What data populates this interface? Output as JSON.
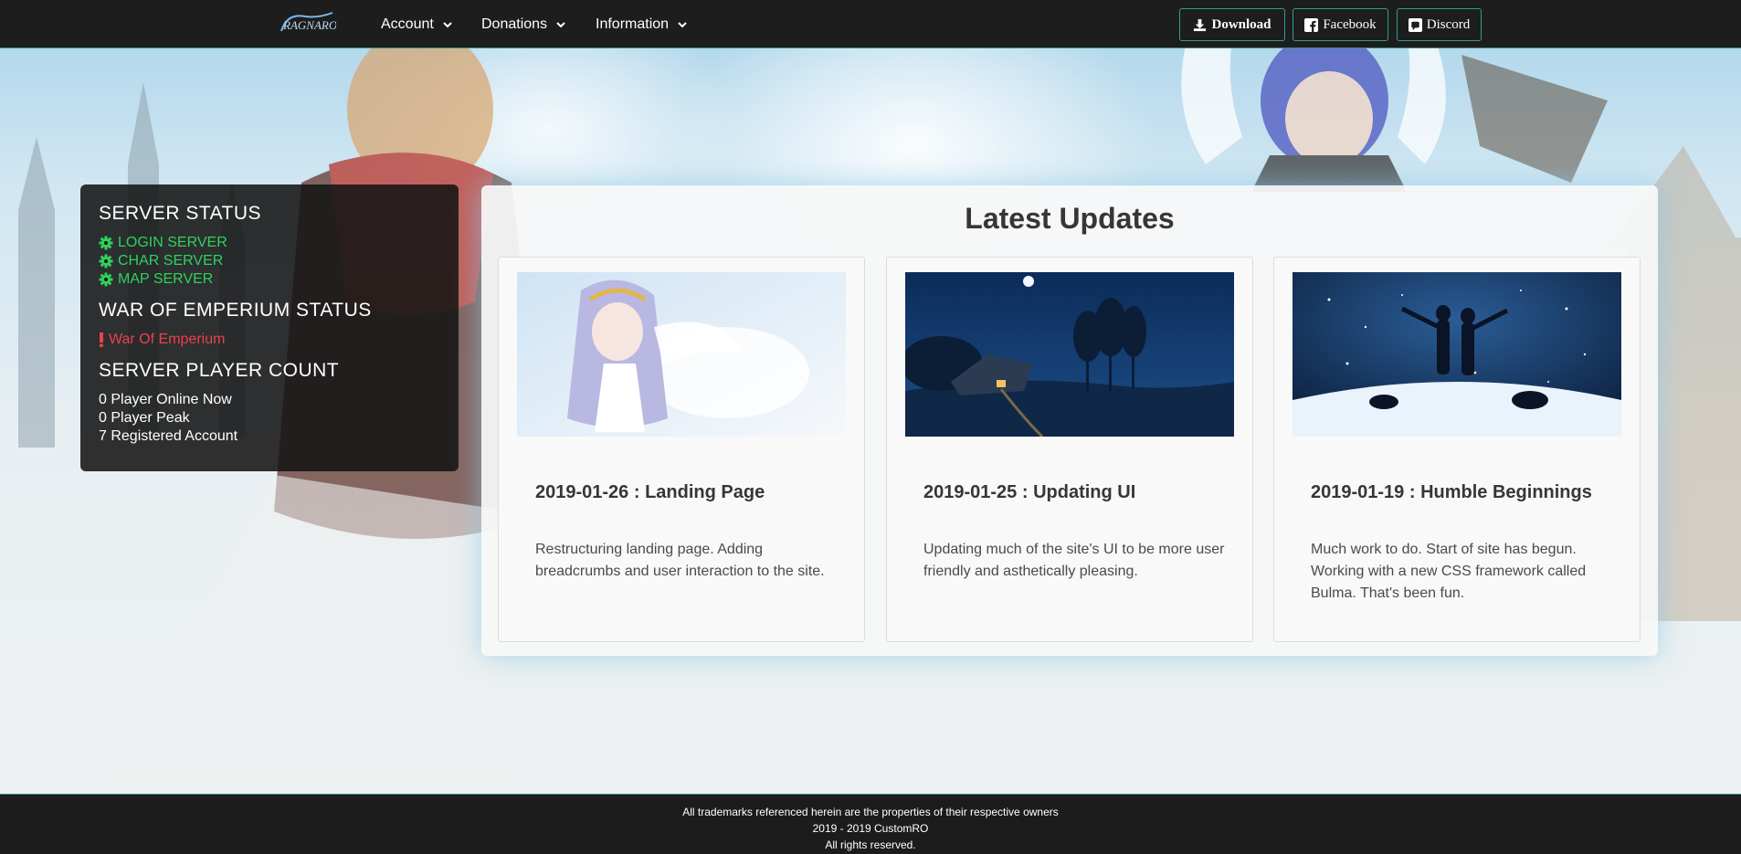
{
  "nav": {
    "logo_alt": "Ragnarok",
    "menu": [
      {
        "label": "Account"
      },
      {
        "label": "Donations"
      },
      {
        "label": "Information"
      }
    ],
    "buttons": {
      "download": "Download",
      "facebook": "Facebook",
      "discord": "Discord"
    }
  },
  "status": {
    "server_heading": "SERVER STATUS",
    "servers": [
      "LOGIN SERVER",
      "CHAR SERVER",
      "MAP SERVER"
    ],
    "woe_heading": "WAR OF EMPERIUM STATUS",
    "woe_label": "War Of Emperium",
    "count_heading": "SERVER PLAYER COUNT",
    "counts": [
      "0 Player Online Now",
      "0 Player Peak",
      "7 Registered Account"
    ]
  },
  "updates": {
    "title": "Latest Updates",
    "cards": [
      {
        "title": "2019-01-26 : Landing Page",
        "body": "Restructuring landing page. Adding breadcrumbs and user interaction to the site."
      },
      {
        "title": "2019-01-25 : Updating UI",
        "body": "Updating much of the site's UI to be more user friendly and asthetically pleasing."
      },
      {
        "title": "2019-01-19 : Humble Beginnings",
        "body": "Much work to do. Start of site has begun. Working with a new CSS framework called Bulma. That's been fun."
      }
    ]
  },
  "footer": {
    "line1": "All trademarks referenced herein are the properties of their respective owners",
    "line2": "2019 - 2019 CustomRO",
    "line3": "All rights reserved."
  },
  "colors": {
    "nav_bg": "#1d1d1d",
    "accent_teal": "#2f9e8f",
    "online_green": "#2ed35b",
    "offline_red": "#ee3f4e"
  },
  "icons": {
    "server": "cog-icon",
    "woe": "exclamation-icon",
    "download": "download-icon",
    "facebook": "facebook-icon",
    "discord": "discord-icon"
  }
}
